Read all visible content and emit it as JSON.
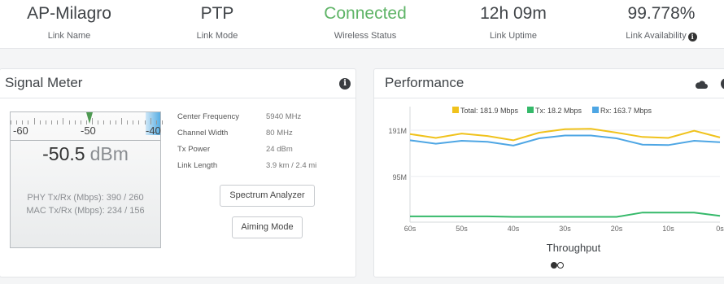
{
  "stats": [
    {
      "value": "AP-Milagro",
      "label": "Link Name"
    },
    {
      "value": "PTP",
      "label": "Link Mode"
    },
    {
      "value": "Connected",
      "label": "Wireless Status"
    },
    {
      "value": "12h 09m",
      "label": "Link Uptime"
    },
    {
      "value": "99.778%",
      "label": "Link Availability"
    }
  ],
  "signal": {
    "title": "Signal Meter",
    "scale_labels": [
      "-60",
      "-50",
      "-40"
    ],
    "needle_value": -50.5,
    "value": "-50.5",
    "unit": "dBm",
    "phy_line": "PHY Tx/Rx (Mbps):  390  /  260",
    "mac_line": "MAC Tx/Rx (Mbps):  234  /  156",
    "details": [
      {
        "key": "Center Frequency",
        "val": "5940 MHz"
      },
      {
        "key": "Channel Width",
        "val": "80 MHz"
      },
      {
        "key": "Tx Power",
        "val": "24 dBm"
      },
      {
        "key": "Link Length",
        "val": "3.9 km / 2.4 mi"
      }
    ],
    "spectrum_button": "Spectrum Analyzer",
    "aiming_button": "Aiming Mode"
  },
  "performance": {
    "title": "Performance",
    "icons": [
      "cloud-icon",
      "info-icon"
    ]
  },
  "colors": {
    "connected": "#5fb467",
    "total": "#f0c21c",
    "tx": "#35b96a",
    "rx": "#4ea6e4"
  },
  "chart_data": {
    "type": "line",
    "xlabel": "Throughput",
    "x": [
      "60s",
      "50s",
      "40s",
      "30s",
      "20s",
      "10s",
      "0s"
    ],
    "y_ticks": [
      "191M",
      "95M"
    ],
    "ylim": [
      0,
      240
    ],
    "series": [
      {
        "name": "Total: 181.9 Mbps",
        "color": "#f0c21c",
        "values": [
          183,
          175,
          184,
          179,
          170,
          186,
          193,
          194,
          186,
          177,
          175,
          190,
          176
        ]
      },
      {
        "name": "Tx: 18.2 Mbps",
        "color": "#35b96a",
        "values": [
          12,
          12,
          12,
          12,
          11,
          11,
          11,
          11,
          11,
          20,
          20,
          20,
          13
        ]
      },
      {
        "name": "Rx: 163.7 Mbps",
        "color": "#4ea6e4",
        "values": [
          170,
          163,
          169,
          167,
          159,
          174,
          180,
          180,
          174,
          161,
          160,
          169,
          166
        ]
      }
    ],
    "pager": [
      "active",
      "inactive"
    ]
  }
}
